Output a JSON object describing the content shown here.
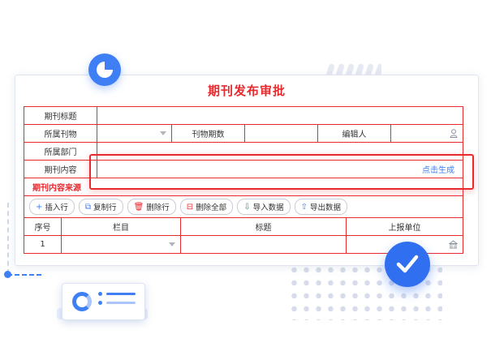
{
  "form": {
    "title": "期刊发布审批",
    "rows": {
      "journal_title_label": "期刊标题",
      "journal_label": "所属刊物",
      "issue_label": "刊物期数",
      "editor_label": "编辑人",
      "dept_label": "所属部门",
      "content_label": "期刊内容",
      "generate_link": "点击生成",
      "source_section": "期刊内容来源"
    },
    "toolbar": {
      "insert_row": "插入行",
      "copy_row": "复制行",
      "delete_row": "删除行",
      "delete_all": "删除全部",
      "import_data": "导入数据",
      "export_data": "导出数据"
    },
    "table": {
      "headers": [
        "序号",
        "栏目",
        "标题",
        "上报单位"
      ],
      "rows": [
        [
          "1",
          "",
          "",
          ""
        ]
      ]
    }
  },
  "colors": {
    "accent": "#e8292e",
    "primary": "#3f7ff6"
  }
}
